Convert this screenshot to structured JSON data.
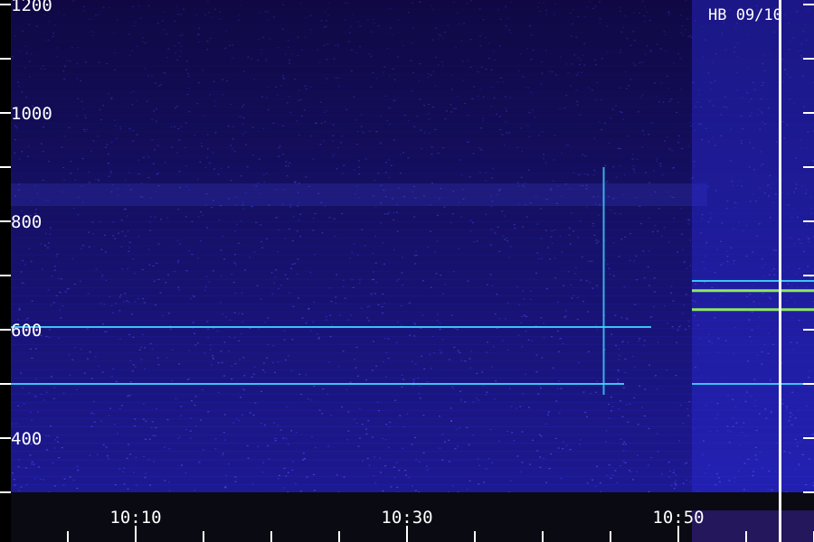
{
  "station": {
    "label": "HB 09/10"
  },
  "colors": {
    "background": "#0b0836",
    "noise_low": "#1a0f6e",
    "noise_high": "#2f34d8",
    "carrier_cyan": "#3fd6ff",
    "carrier_green": "#9cff5a",
    "axis": "#ffffff"
  },
  "chart_data": {
    "type": "heatmap",
    "title": "",
    "xlabel": "",
    "ylabel": "",
    "x_ticks": [
      {
        "label": "10:10",
        "minute": 10
      },
      {
        "label": "10:30",
        "minute": 30
      },
      {
        "label": "10:50",
        "minute": 50
      }
    ],
    "x_minor_tick_minutes": [
      5,
      10,
      15,
      20,
      25,
      30,
      35,
      40,
      45,
      50,
      55,
      60
    ],
    "xlim_minutes": [
      0,
      60
    ],
    "y_ticks": [
      {
        "label": "400",
        "value": 400
      },
      {
        "label": "600",
        "value": 600
      },
      {
        "label": "800",
        "value": 800
      },
      {
        "label": "1000",
        "value": 1000
      },
      {
        "label": "1200",
        "value": 1200
      }
    ],
    "y_minor_tick_values": [
      300,
      500,
      700,
      900,
      1100
    ],
    "ylim": [
      300,
      1200
    ],
    "carriers": [
      {
        "freq": 500,
        "start_minute": 0,
        "end_minute": 46,
        "color": "cyan"
      },
      {
        "freq": 605,
        "start_minute": 0,
        "end_minute": 48,
        "color": "cyan"
      },
      {
        "freq": 500,
        "start_minute": 51,
        "end_minute": 60,
        "color": "cyan"
      },
      {
        "freq": 672,
        "start_minute": 51,
        "end_minute": 60,
        "color": "green"
      },
      {
        "freq": 637,
        "start_minute": 51,
        "end_minute": 60,
        "color": "green"
      },
      {
        "freq": 690,
        "start_minute": 51,
        "end_minute": 60,
        "color": "cyan"
      }
    ],
    "events": [
      {
        "type": "vertical_spike",
        "minute": 44.5,
        "freq_from": 480,
        "freq_to": 900
      }
    ],
    "quiet_band_freq": [
      300,
      312
    ],
    "bright_region_start_minute": 51,
    "right_marker_minute": 57.5
  }
}
